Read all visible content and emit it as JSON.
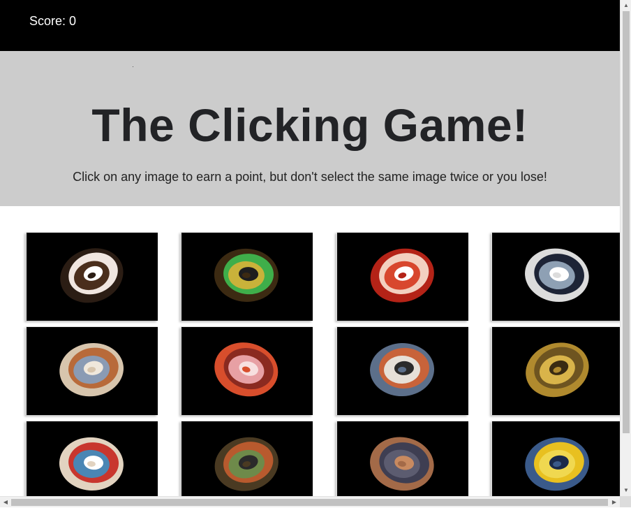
{
  "navbar": {
    "score_label": "Score: 0"
  },
  "header": {
    "title": "The Clicking Game!",
    "subtitle": "Click on any image to earn a point, but don't select the same image twice or you lose!"
  },
  "cards": [
    {
      "name": "stone-image-1",
      "colors": [
        "#2b1d14",
        "#f0e6e0",
        "#4a2e1c",
        "#ffffff"
      ]
    },
    {
      "name": "stone-image-2",
      "colors": [
        "#3c2a12",
        "#3fae4a",
        "#c9b23a",
        "#1e1e1e"
      ]
    },
    {
      "name": "stone-image-3",
      "colors": [
        "#b42317",
        "#f3d0c0",
        "#d8472e",
        "#ffffff"
      ]
    },
    {
      "name": "stone-image-4",
      "colors": [
        "#dcdcdc",
        "#1d2436",
        "#8ea0b4",
        "#ffffff"
      ]
    },
    {
      "name": "stone-image-5",
      "colors": [
        "#d7c5ad",
        "#b86a3a",
        "#8a9bb4",
        "#f0e8dc"
      ]
    },
    {
      "name": "stone-image-6",
      "colors": [
        "#d84e2c",
        "#8a2a20",
        "#e7a0a4",
        "#f7e0e0"
      ]
    },
    {
      "name": "stone-image-7",
      "colors": [
        "#5c6f8a",
        "#c8633a",
        "#e6e0d8",
        "#2b2b2b"
      ]
    },
    {
      "name": "stone-image-8",
      "colors": [
        "#b08a2e",
        "#6e5420",
        "#d9b44a",
        "#3a2b12"
      ]
    },
    {
      "name": "stone-image-9",
      "colors": [
        "#e2d3c0",
        "#c8362e",
        "#4a86b4",
        "#ffffff"
      ]
    },
    {
      "name": "stone-image-10",
      "colors": [
        "#4a3a22",
        "#b85a2e",
        "#6e8a4a",
        "#2a2a2a"
      ]
    },
    {
      "name": "stone-image-11",
      "colors": [
        "#a36a48",
        "#3e3e52",
        "#5c5c70",
        "#c88a60"
      ]
    },
    {
      "name": "stone-image-12",
      "colors": [
        "#3a5a8a",
        "#e8c020",
        "#f0d850",
        "#1a2a4a"
      ]
    }
  ]
}
